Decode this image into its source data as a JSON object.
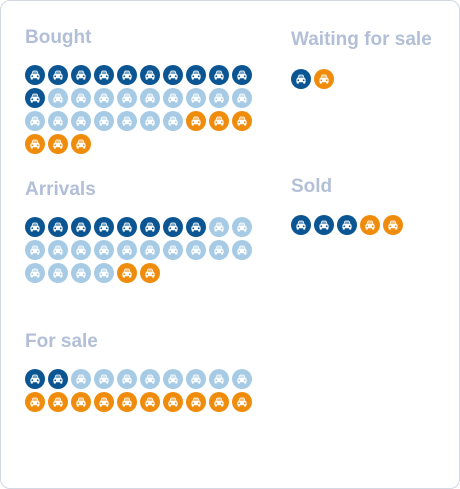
{
  "chart_data": {
    "type": "pictogram",
    "colors": {
      "dark_blue": "#0a5592",
      "light_blue": "#a7cbe5",
      "orange": "#f08c0c"
    },
    "icon": "car-icon",
    "groups": [
      {
        "key": "bought",
        "title": "Bought",
        "counts": {
          "dark_blue": 11,
          "light_blue": 16,
          "orange": 6
        }
      },
      {
        "key": "waiting",
        "title": "Waiting for sale",
        "counts": {
          "dark_blue": 1,
          "light_blue": 0,
          "orange": 1
        }
      },
      {
        "key": "arrivals",
        "title": "Arrivals",
        "counts": {
          "dark_blue": 8,
          "light_blue": 16,
          "orange": 2
        }
      },
      {
        "key": "sold",
        "title": "Sold",
        "counts": {
          "dark_blue": 3,
          "light_blue": 0,
          "orange": 2
        }
      },
      {
        "key": "forsale",
        "title": "For sale",
        "counts": {
          "dark_blue": 2,
          "light_blue": 8,
          "orange": 10
        }
      }
    ]
  }
}
